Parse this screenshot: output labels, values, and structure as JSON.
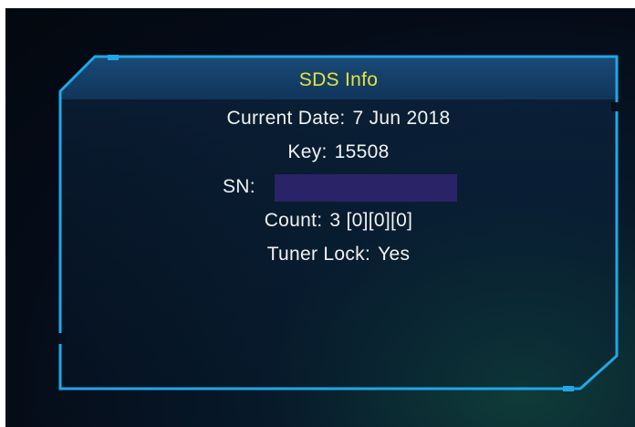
{
  "dialog": {
    "title": "SDS Info",
    "current_date_label": "Current Date:",
    "current_date_value": "7 Jun 2018",
    "key_label": "Key:",
    "key_value": "15508",
    "sn_label": "SN:",
    "sn_value": "",
    "count_label": "Count:",
    "count_value": "3 [0][0][0]",
    "tuner_lock_label": "Tuner Lock:",
    "tuner_lock_value": "Yes"
  },
  "colors": {
    "title": "#e8e23a",
    "text": "#f2f2f2",
    "frame": "#1fa8e6",
    "header_band": "#123a60",
    "sn_redaction": "#2b2368"
  }
}
